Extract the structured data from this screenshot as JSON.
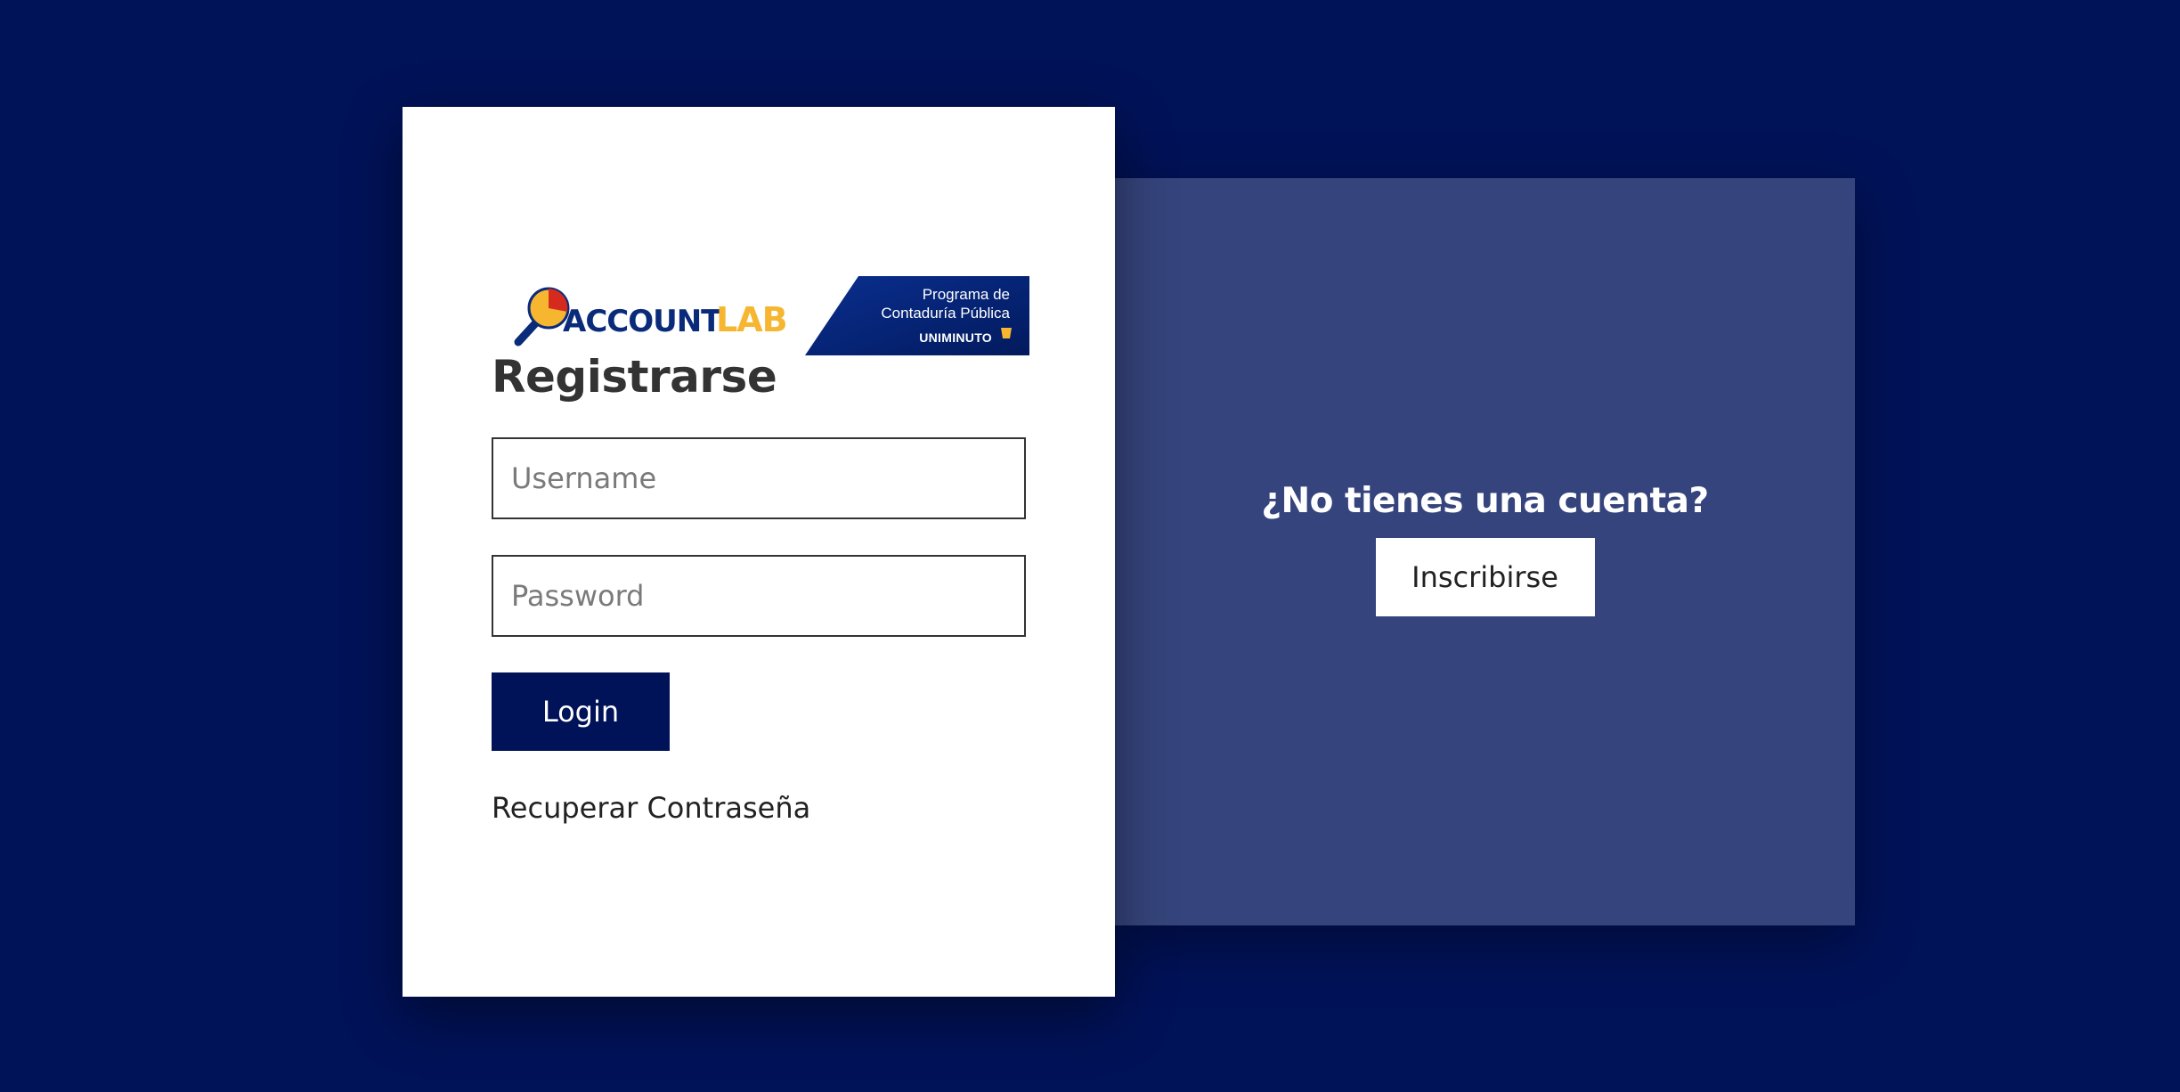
{
  "logo": {
    "brand_left": "ACCOUNT",
    "brand_right": "LAB",
    "badge_line1": "Programa de",
    "badge_line2": "Contaduría Pública",
    "badge_brand": "UNIMINUTO"
  },
  "login": {
    "title": "Registrarse",
    "username_placeholder": "Username",
    "password_placeholder": "Password",
    "login_label": "Login",
    "recover_label": "Recuperar Contraseña"
  },
  "signup": {
    "question": "¿No tienes una cuenta?",
    "button_label": "Inscribirse"
  },
  "colors": {
    "background": "#001258",
    "panel": "#35447c",
    "accent": "#f6b630"
  }
}
